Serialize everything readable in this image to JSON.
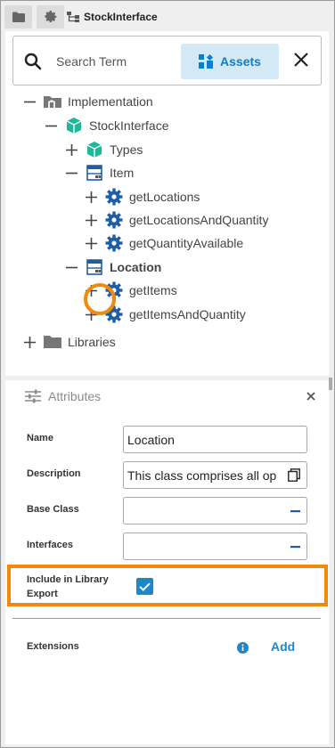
{
  "tabbar": {
    "tabs": [
      {
        "icon": "folder-icon"
      },
      {
        "icon": "gear-icon"
      }
    ],
    "active_tab": {
      "icon": "class-hierarchy-icon",
      "label": "StockInterface"
    }
  },
  "search": {
    "placeholder": "Search Term",
    "assets_label": "Assets"
  },
  "tree": [
    {
      "label": "Implementation",
      "expander": "minus",
      "icon": "implementation-folder-icon"
    },
    {
      "label": "StockInterface",
      "expander": "minus",
      "icon": "component-cube-icon"
    },
    {
      "label": "Types",
      "expander": "plus",
      "icon": "component-cube-icon"
    },
    {
      "label": "Item",
      "expander": "minus",
      "icon": "class-icon"
    },
    {
      "label": "getLocations",
      "expander": "plus",
      "icon": "operation-gear-icon"
    },
    {
      "label": "getLocationsAndQuantity",
      "expander": "plus",
      "icon": "operation-gear-icon"
    },
    {
      "label": "getQuantityAvailable",
      "expander": "plus",
      "icon": "operation-gear-icon"
    },
    {
      "label": "Location",
      "expander": "minus",
      "icon": "class-icon",
      "selected": true
    },
    {
      "label": "getItems",
      "expander": "plus",
      "icon": "operation-gear-icon"
    },
    {
      "label": "getItemsAndQuantity",
      "expander": "plus",
      "icon": "operation-gear-icon"
    },
    {
      "label": "Libraries",
      "expander": "plus",
      "icon": "folder-icon"
    }
  ],
  "attributes": {
    "title": "Attributes",
    "fields": {
      "name": {
        "label": "Name",
        "value": "Location"
      },
      "description": {
        "label": "Description",
        "value": "This class comprises all op"
      },
      "base_class": {
        "label": "Base Class",
        "value": ""
      },
      "interfaces": {
        "label": "Interfaces",
        "value": ""
      }
    },
    "include_export": {
      "label_line1": "Include in Library",
      "label_line2": "Export",
      "checked": true
    },
    "extensions": {
      "label": "Extensions",
      "add_label": "Add"
    }
  },
  "colors": {
    "accent": "#1e87c8",
    "highlight": "#ef8a0c",
    "cube": "#1bb99a"
  }
}
